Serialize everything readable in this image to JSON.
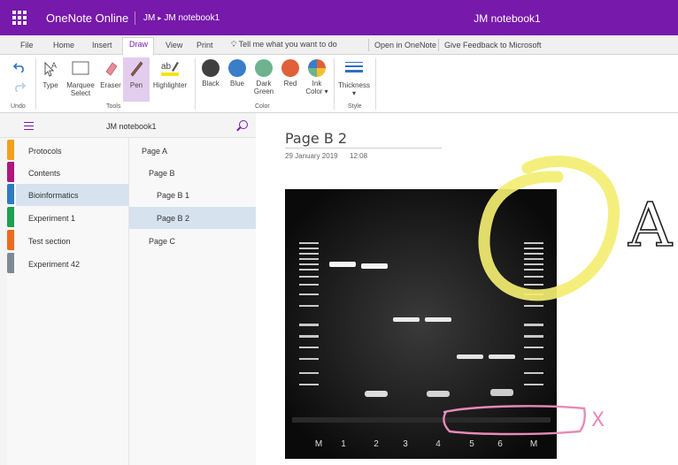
{
  "app": {
    "name": "OneNote Online",
    "breadcrumb_user": "JM",
    "breadcrumb_notebook": "JM notebook1",
    "window_title": "JM notebook1"
  },
  "tabs": [
    "File",
    "Home",
    "Insert",
    "Draw",
    "View",
    "Print"
  ],
  "active_tab": "Draw",
  "tell_me": "Tell me what you want to do",
  "links": {
    "open_in_onenote": "Open in OneNote",
    "feedback": "Give Feedback to Microsoft"
  },
  "ribbon": {
    "undo_group": "Undo",
    "tools_group": "Tools",
    "color_group": "Color",
    "style_group": "Style",
    "tools": {
      "type": "Type",
      "marquee_line1": "Marquee",
      "marquee_line2": "Select",
      "eraser": "Eraser",
      "pen": "Pen",
      "highlighter": "Highlighter"
    },
    "colors": [
      {
        "label": "Black",
        "color": "#404040"
      },
      {
        "label": "Blue",
        "color": "#3a7dc9"
      },
      {
        "label": "Dark",
        "label2": "Green",
        "color": "#6db38f"
      },
      {
        "label": "Red",
        "color": "#e0603a"
      },
      {
        "label": "Ink",
        "label2": "Color",
        "color": "multi"
      }
    ],
    "thickness": "Thickness"
  },
  "notebook": {
    "title": "JM notebook1",
    "sections": [
      {
        "label": "Protocols",
        "color": "#f2a01e"
      },
      {
        "label": "Contents",
        "color": "#b0177e"
      },
      {
        "label": "Bioinformatics",
        "color": "#2e7bc4"
      },
      {
        "label": "Experiment 1",
        "color": "#20a04f"
      },
      {
        "label": "Test section",
        "color": "#ee6a1d"
      },
      {
        "label": "Experiment 42",
        "color": "#7d8a96"
      }
    ],
    "selected_section": "Bioinformatics",
    "pages": [
      "Page A",
      "Page B",
      "Page B 1",
      "Page B 2",
      "Page C"
    ],
    "selected_page": "Page B 2"
  },
  "page": {
    "title": "Page B 2",
    "date": "29 January 2019",
    "time": "12:08"
  },
  "gel": {
    "lane_labels": [
      "M",
      "1",
      "2",
      "3",
      "4",
      "5",
      "6",
      "M"
    ]
  },
  "annotations": {
    "letter_a": "A",
    "mark_x": "X",
    "highlight_color": "#f3ee72",
    "pink_color": "#e88ab8"
  }
}
